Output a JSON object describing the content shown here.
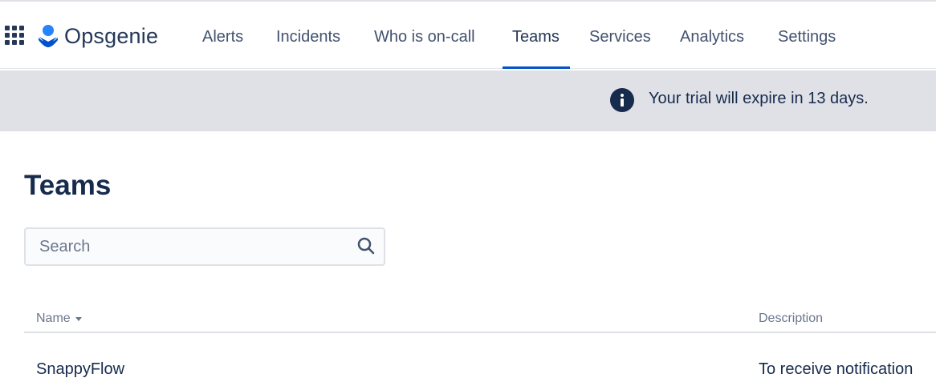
{
  "app": {
    "name": "Opsgenie"
  },
  "nav": {
    "items": [
      {
        "label": "Alerts"
      },
      {
        "label": "Incidents"
      },
      {
        "label": "Who is on-call"
      },
      {
        "label": "Teams",
        "active": true
      },
      {
        "label": "Services"
      },
      {
        "label": "Analytics"
      },
      {
        "label": "Settings"
      }
    ]
  },
  "banner": {
    "icon": "info-icon",
    "text": "Your trial will expire in 13 days."
  },
  "page": {
    "title": "Teams"
  },
  "search": {
    "placeholder": "Search",
    "value": "",
    "icon": "search-icon"
  },
  "table": {
    "columns": [
      {
        "label": "Name",
        "sort": "descending"
      },
      {
        "label": "Description"
      }
    ],
    "rows": [
      {
        "name": "SnappyFlow",
        "description": "To receive notification"
      }
    ]
  },
  "colors": {
    "accent": "#0052cc",
    "banner_bg": "#dfe1e6",
    "text_primary": "#172b4d",
    "text_secondary": "#6b778c"
  }
}
